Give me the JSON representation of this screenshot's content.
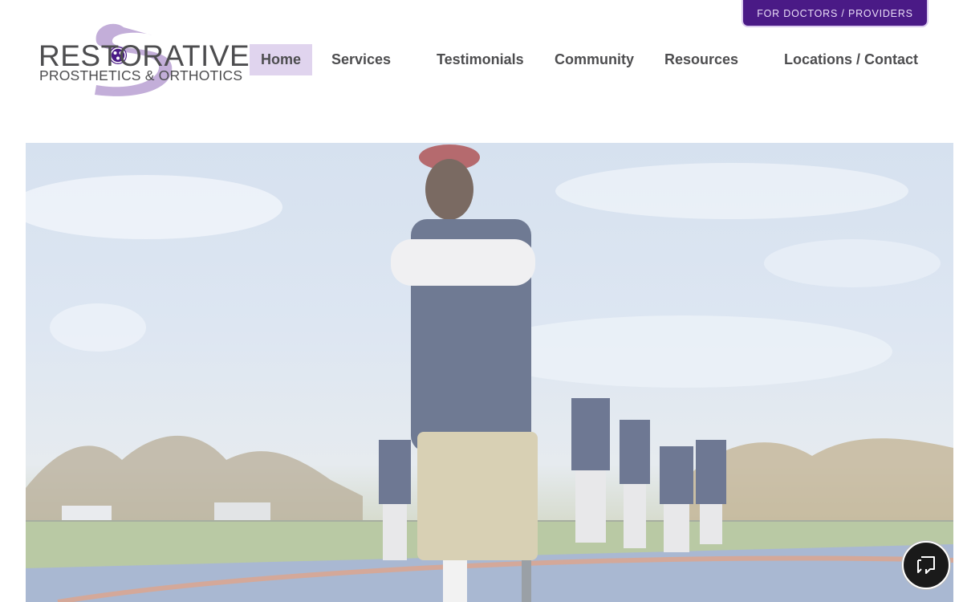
{
  "header": {
    "provider_button": "FOR DOCTORS / PROVIDERS",
    "logo": {
      "line1": "RESTORATIVE",
      "line2": "PROSTHETICS & ORTHOTICS"
    },
    "nav": [
      {
        "label": "Home",
        "active": true
      },
      {
        "label": "Services",
        "active": false
      },
      {
        "label": "Testimonials",
        "active": false
      },
      {
        "label": "Community",
        "active": false
      },
      {
        "label": "Resources",
        "active": false
      },
      {
        "label": "Locations / Contact",
        "active": false
      }
    ]
  },
  "hero": {
    "image": "Coach with prosthetic leg standing arms crossed on football field with players"
  },
  "chat": {
    "icon": "chat-bubble-icon"
  },
  "colors": {
    "brand_purple": "#4a1a86",
    "nav_active_bg": "#e0d4ee",
    "text_gray": "#4d4d4f"
  }
}
